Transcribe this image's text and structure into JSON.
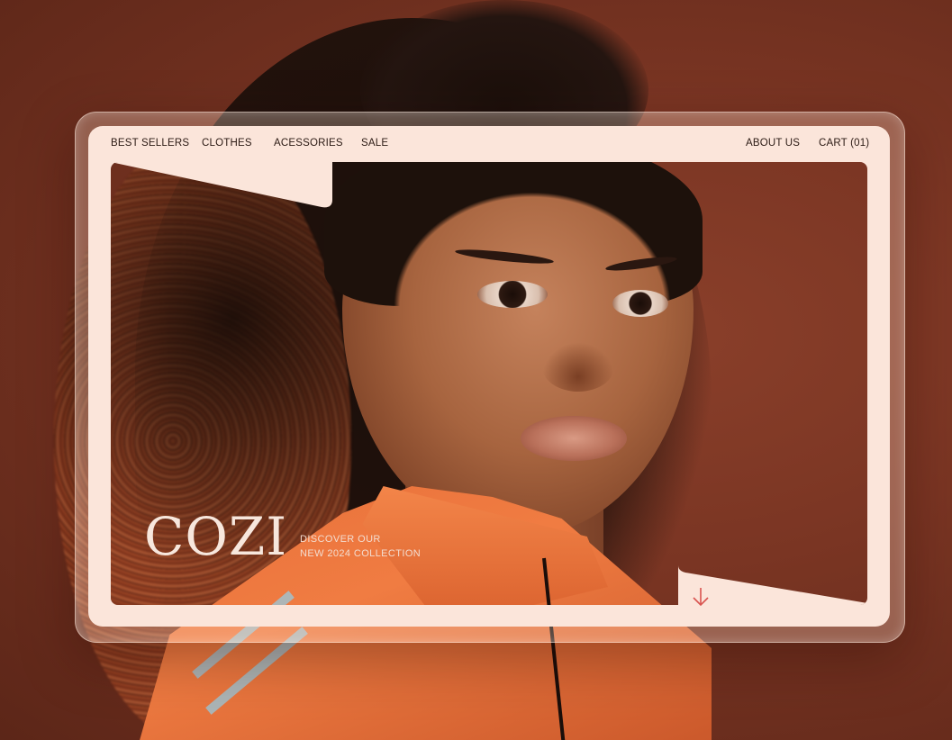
{
  "nav": {
    "left": [
      {
        "label": "BEST SELLERS"
      },
      {
        "label": "CLOTHES"
      },
      {
        "label": "ACESSORIES"
      },
      {
        "label": "SALE"
      }
    ],
    "right": [
      {
        "label": "ABOUT US"
      },
      {
        "label": "CART (01)"
      }
    ]
  },
  "hero": {
    "brand": "COZI",
    "tagline_line1": "DISCOVER OUR",
    "tagline_line2": "NEW 2024 COLLECTION",
    "scroll_icon": "arrow-down-icon"
  },
  "colors": {
    "panel": "#fbe5da",
    "accent": "#d9534f",
    "text": "#2b1a14"
  }
}
